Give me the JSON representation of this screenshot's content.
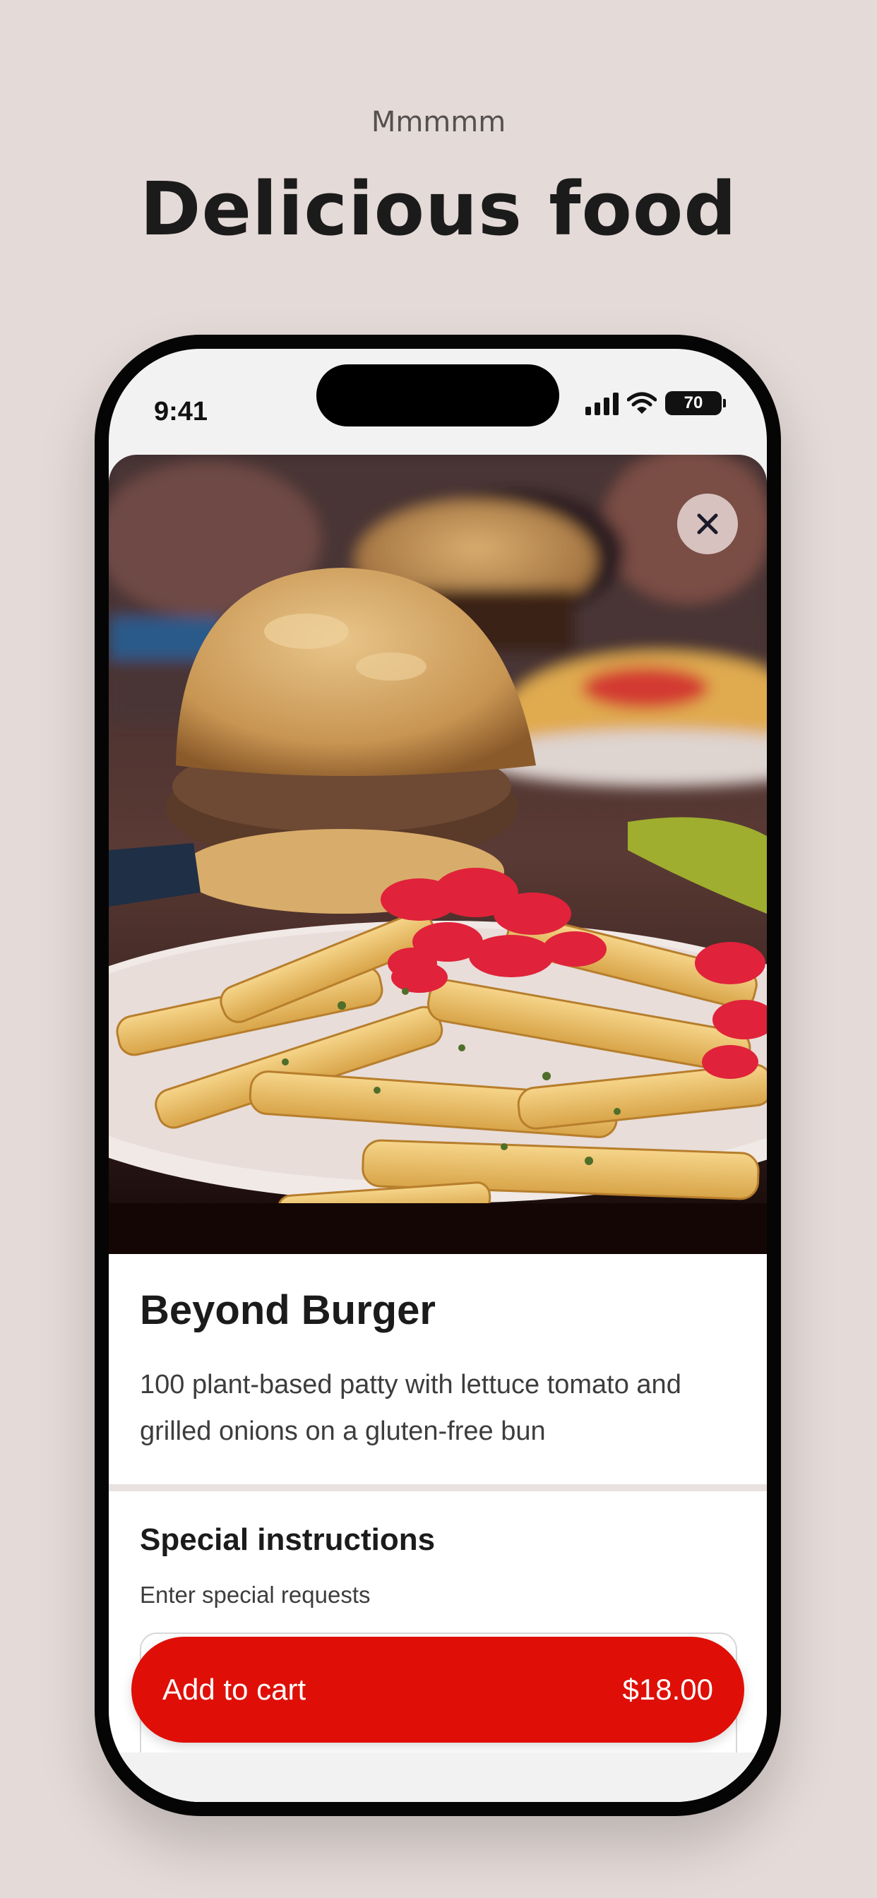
{
  "header": {
    "eyebrow": "Mmmmm",
    "headline": "Delicious food"
  },
  "status_bar": {
    "time": "9:41",
    "battery": "70"
  },
  "item": {
    "image_icon": "burger-and-fries-photo",
    "name": "Beyond Burger",
    "description": "100 plant-based patty with lettuce tomato and grilled onions on a gluten-free bun"
  },
  "special_instructions": {
    "title": "Special instructions",
    "hint": "Enter special requests",
    "value": ""
  },
  "cart_button": {
    "label": "Add to cart",
    "price": "$18.00"
  },
  "colors": {
    "background": "#e4dad8",
    "accent": "#df0f07"
  }
}
